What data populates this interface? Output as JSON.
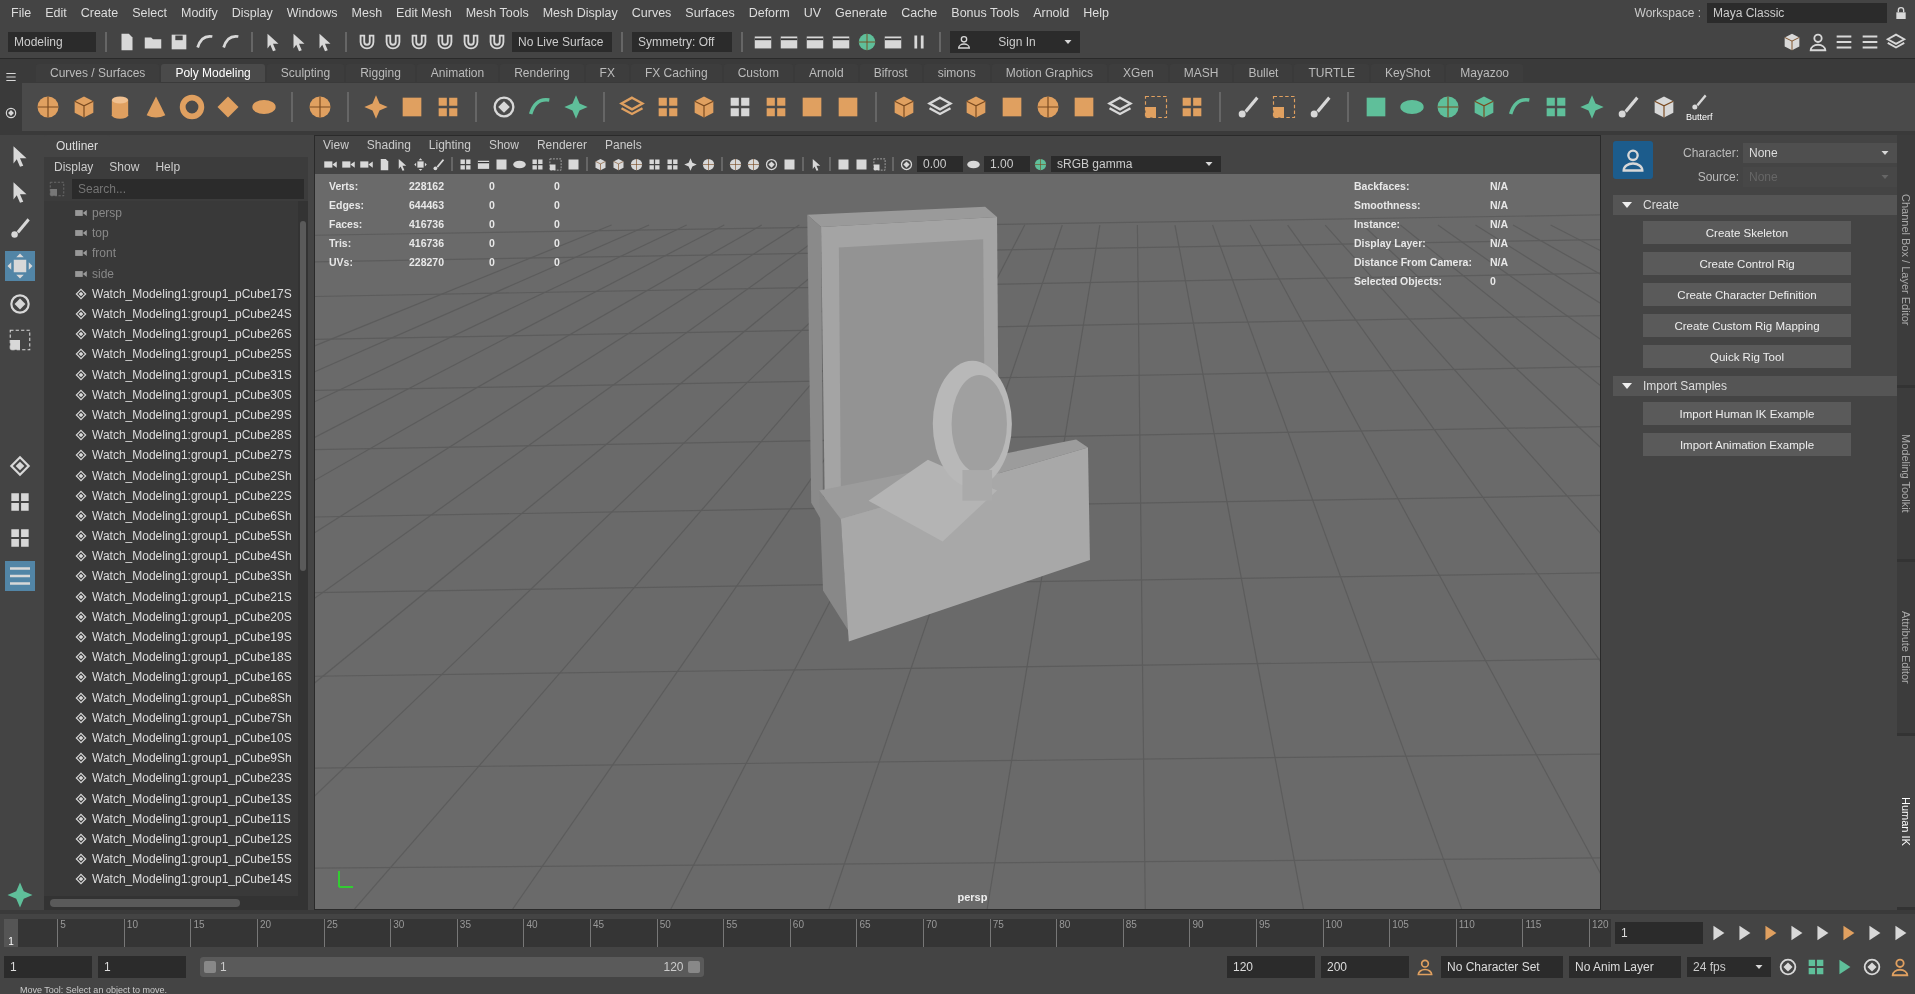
{
  "menu_bar": [
    "File",
    "Edit",
    "Create",
    "Select",
    "Modify",
    "Display",
    "Windows",
    "Mesh",
    "Edit Mesh",
    "Mesh Tools",
    "Mesh Display",
    "Curves",
    "Surfaces",
    "Deform",
    "UV",
    "Generate",
    "Cache",
    "Bonus Tools",
    "Arnold",
    "Help"
  ],
  "workspace": {
    "label": "Workspace :",
    "value": "Maya Classic"
  },
  "status_line": {
    "mode": "Modeling",
    "live_surface": "No Live Surface",
    "symmetry": "Symmetry: Off",
    "sign_in": "Sign In"
  },
  "shelf": {
    "tabs": [
      {
        "label": "Curves / Surfaces",
        "selected": false
      },
      {
        "label": "Poly Modeling",
        "selected": true
      },
      {
        "label": "Sculpting",
        "selected": false
      },
      {
        "label": "Rigging",
        "selected": false
      },
      {
        "label": "Animation",
        "selected": false
      },
      {
        "label": "Rendering",
        "selected": false
      },
      {
        "label": "FX",
        "selected": false
      },
      {
        "label": "FX Caching",
        "selected": false
      },
      {
        "label": "Custom",
        "selected": false
      },
      {
        "label": "Arnold",
        "selected": false
      },
      {
        "label": "Bifrost",
        "selected": false
      },
      {
        "label": "simons",
        "selected": false
      },
      {
        "label": "Motion Graphics",
        "selected": false
      },
      {
        "label": "XGen",
        "selected": false
      },
      {
        "label": "MASH",
        "selected": false
      },
      {
        "label": "Bullet",
        "selected": false
      },
      {
        "label": "TURTLE",
        "selected": false
      },
      {
        "label": "KeyShot",
        "selected": false
      },
      {
        "label": "Mayazoo",
        "selected": false
      }
    ],
    "last_button": "Butterf"
  },
  "outliner": {
    "title": "Outliner",
    "menu": [
      "Display",
      "Show",
      "Help"
    ],
    "search": {
      "placeholder": "Search..."
    },
    "items": [
      {
        "kind": "camera",
        "label": "persp"
      },
      {
        "kind": "camera",
        "label": "top"
      },
      {
        "kind": "camera",
        "label": "front"
      },
      {
        "kind": "camera",
        "label": "side"
      },
      {
        "kind": "mesh",
        "label": "Watch_Modeling1:group1_pCube17S"
      },
      {
        "kind": "mesh",
        "label": "Watch_Modeling1:group1_pCube24S"
      },
      {
        "kind": "mesh",
        "label": "Watch_Modeling1:group1_pCube26S"
      },
      {
        "kind": "mesh",
        "label": "Watch_Modeling1:group1_pCube25S"
      },
      {
        "kind": "mesh",
        "label": "Watch_Modeling1:group1_pCube31S"
      },
      {
        "kind": "mesh",
        "label": "Watch_Modeling1:group1_pCube30S"
      },
      {
        "kind": "mesh",
        "label": "Watch_Modeling1:group1_pCube29S"
      },
      {
        "kind": "mesh",
        "label": "Watch_Modeling1:group1_pCube28S"
      },
      {
        "kind": "mesh",
        "label": "Watch_Modeling1:group1_pCube27S"
      },
      {
        "kind": "mesh",
        "label": "Watch_Modeling1:group1_pCube2Sh"
      },
      {
        "kind": "mesh",
        "label": "Watch_Modeling1:group1_pCube22S"
      },
      {
        "kind": "mesh",
        "label": "Watch_Modeling1:group1_pCube6Sh"
      },
      {
        "kind": "mesh",
        "label": "Watch_Modeling1:group1_pCube5Sh"
      },
      {
        "kind": "mesh",
        "label": "Watch_Modeling1:group1_pCube4Sh"
      },
      {
        "kind": "mesh",
        "label": "Watch_Modeling1:group1_pCube3Sh"
      },
      {
        "kind": "mesh",
        "label": "Watch_Modeling1:group1_pCube21S"
      },
      {
        "kind": "mesh",
        "label": "Watch_Modeling1:group1_pCube20S"
      },
      {
        "kind": "mesh",
        "label": "Watch_Modeling1:group1_pCube19S"
      },
      {
        "kind": "mesh",
        "label": "Watch_Modeling1:group1_pCube18S"
      },
      {
        "kind": "mesh",
        "label": "Watch_Modeling1:group1_pCube16S"
      },
      {
        "kind": "mesh",
        "label": "Watch_Modeling1:group1_pCube8Sh"
      },
      {
        "kind": "mesh",
        "label": "Watch_Modeling1:group1_pCube7Sh"
      },
      {
        "kind": "mesh",
        "label": "Watch_Modeling1:group1_pCube10S"
      },
      {
        "kind": "mesh",
        "label": "Watch_Modeling1:group1_pCube9Sh"
      },
      {
        "kind": "mesh",
        "label": "Watch_Modeling1:group1_pCube23S"
      },
      {
        "kind": "mesh",
        "label": "Watch_Modeling1:group1_pCube13S"
      },
      {
        "kind": "mesh",
        "label": "Watch_Modeling1:group1_pCube11S"
      },
      {
        "kind": "mesh",
        "label": "Watch_Modeling1:group1_pCube12S"
      },
      {
        "kind": "mesh",
        "label": "Watch_Modeling1:group1_pCube15S"
      },
      {
        "kind": "mesh",
        "label": "Watch_Modeling1:group1_pCube14S"
      }
    ]
  },
  "viewport": {
    "menu": [
      "View",
      "Shading",
      "Lighting",
      "Show",
      "Renderer",
      "Panels"
    ],
    "exposure": "0.00",
    "gamma": "1.00",
    "color_space": "sRGB gamma",
    "camera": "persp",
    "stats": [
      {
        "label": "Verts:",
        "values": [
          "228162",
          "0",
          "0"
        ]
      },
      {
        "label": "Edges:",
        "values": [
          "644463",
          "0",
          "0"
        ]
      },
      {
        "label": "Faces:",
        "values": [
          "416736",
          "0",
          "0"
        ]
      },
      {
        "label": "Tris:",
        "values": [
          "416736",
          "0",
          "0"
        ]
      },
      {
        "label": "UVs:",
        "values": [
          "228270",
          "0",
          "0"
        ]
      }
    ],
    "info": [
      {
        "label": "Backfaces:",
        "value": "N/A"
      },
      {
        "label": "Smoothness:",
        "value": "N/A"
      },
      {
        "label": "Instance:",
        "value": "N/A"
      },
      {
        "label": "Display Layer:",
        "value": "N/A"
      },
      {
        "label": "Distance From Camera:",
        "value": "N/A"
      },
      {
        "label": "Selected Objects:",
        "value": "0"
      }
    ]
  },
  "human_ik": {
    "character": {
      "label": "Character:",
      "value": "None"
    },
    "source": {
      "label": "Source:",
      "value": "None",
      "disabled": true
    },
    "sections": [
      {
        "title": "Create",
        "expanded": true,
        "buttons": [
          "Create Skeleton",
          "Create Control Rig",
          "Create Character Definition",
          "Create Custom Rig Mapping",
          "Quick Rig Tool"
        ]
      },
      {
        "title": "Import Samples",
        "expanded": true,
        "buttons": [
          "Import Human IK Example",
          "Import Animation Example"
        ]
      }
    ]
  },
  "side_tabs": [
    {
      "label": "Channel Box / Layer Editor",
      "selected": false
    },
    {
      "label": "Modeling Toolkit",
      "selected": false
    },
    {
      "label": "Attribute Editor",
      "selected": false
    },
    {
      "label": "Human IK",
      "selected": true
    }
  ],
  "timeline": {
    "current_frame": "1",
    "level": 0,
    "ticks": [
      "5",
      "10",
      "15",
      "20",
      "25",
      "30",
      "35",
      "40",
      "45",
      "50",
      "55",
      "60",
      "65",
      "70",
      "75",
      "80",
      "85",
      "90",
      "95",
      "100",
      "105",
      "110",
      "115",
      "120"
    ],
    "frame_field": "1"
  },
  "range": {
    "start": "1",
    "playback_start": "1",
    "slider_start": "1",
    "slider_end": "120",
    "level": 1,
    "playback_end": "120",
    "end": "200",
    "character_set": "No Character Set",
    "anim_layer": "No Anim Layer",
    "fps": "24 fps"
  },
  "help_line": "Move Tool: Select an object to move."
}
